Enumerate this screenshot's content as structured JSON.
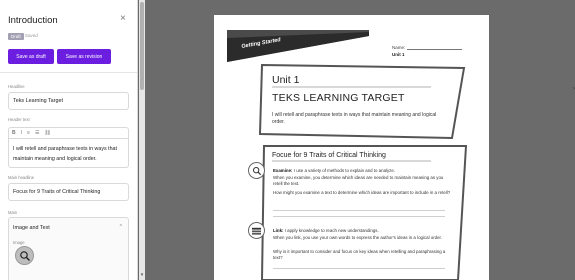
{
  "panel": {
    "title": "Introduction",
    "status_badge": "Draft",
    "status_text": "Saved",
    "save_draft_label": "Save as draft",
    "save_revision_label": "Save as revision",
    "headline_label": "Headline",
    "headline_value": "Teks Learning Target",
    "header_text_label": "Header text",
    "header_text_value": "I will retell and paraphrase texts in ways that maintain meaning and logical order.",
    "main_headline_label": "Main headline",
    "main_headline_value": "Focus for 9 Traits of Critical Thinking",
    "main_label": "Main",
    "main_section_title": "Image and Text",
    "image_label": "Image"
  },
  "doc": {
    "banner": "Getting Started",
    "name_label": "Name:",
    "unit_small": "Unit 1",
    "unit_title": "Unit 1",
    "teks_title": "TEKS LEARNING TARGET",
    "teks_text": "I will retell and paraphrase texts in ways that maintain meaning and logical order.",
    "focus_title": "Focue for 9 Traits of Critical Thinking",
    "examine_bold": "Examine:",
    "examine_def": " I use a variety of methods to explain and to analyze.",
    "examine_line1": "When you examine, you determine which ideas are needed to maintain meaning as you retell the text.",
    "examine_line2": "How might you examine a text to determine which ideas are important to include in a retell?",
    "link_bold": "Link:",
    "link_def": " I apply knowledge to reach new understandings.",
    "link_line1": "When you link, you use your own words to express the author's ideas in a logical order.",
    "link_line2": "Why is it important to consider and focus on key ideas when retelling and paraphrasing a text?"
  },
  "colors": {
    "accent": "#6c1ee0",
    "preview_bg": "#6b6b6b"
  }
}
